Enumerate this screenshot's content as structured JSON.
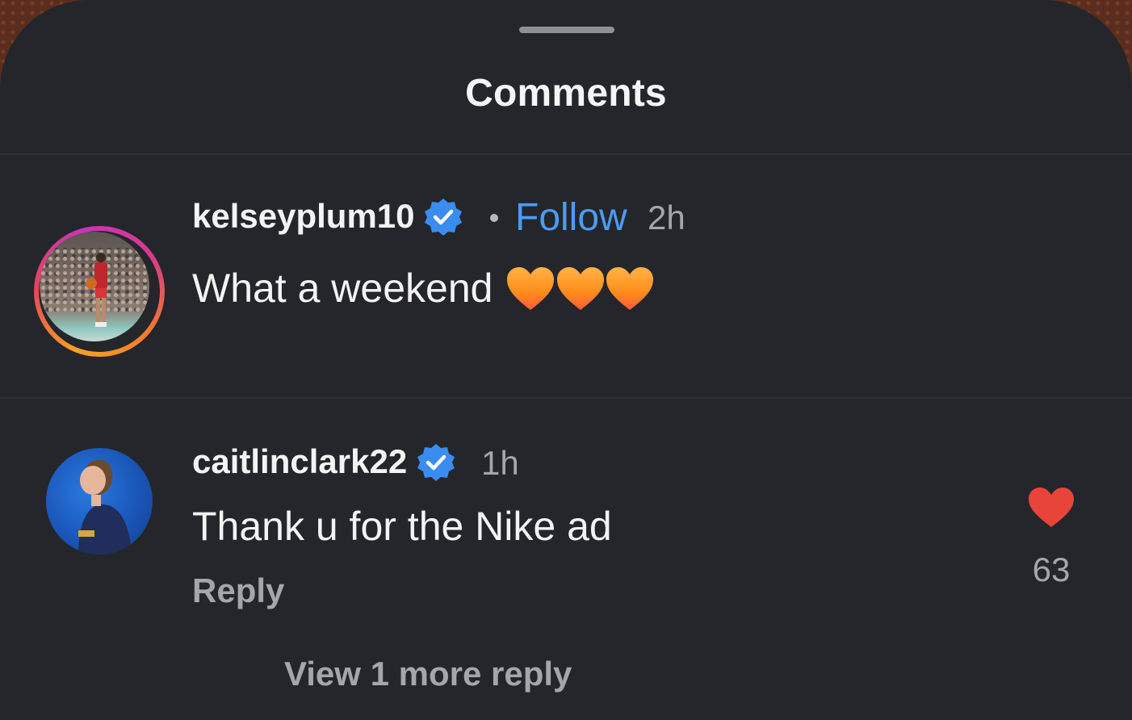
{
  "sheet": {
    "title": "Comments"
  },
  "comments": [
    {
      "username": "kelseyplum10",
      "verified": true,
      "follow_label": "Follow",
      "time": "2h",
      "text": "What a weekend",
      "emoji": [
        "orange-heart",
        "orange-heart",
        "orange-heart"
      ],
      "avatar_ring": "story-gradient"
    },
    {
      "username": "caitlinclark22",
      "verified": true,
      "time": "1h",
      "text": "Thank u for the Nike ad",
      "reply_label": "Reply",
      "like_count": "63",
      "liked": true,
      "view_more_label": "View 1 more reply"
    }
  ],
  "colors": {
    "background": "#24262b",
    "follow": "#4a9cf5",
    "verified": "#3b8cf0",
    "liked_heart": "#e8443a",
    "secondary_text": "#a3a6ab"
  }
}
